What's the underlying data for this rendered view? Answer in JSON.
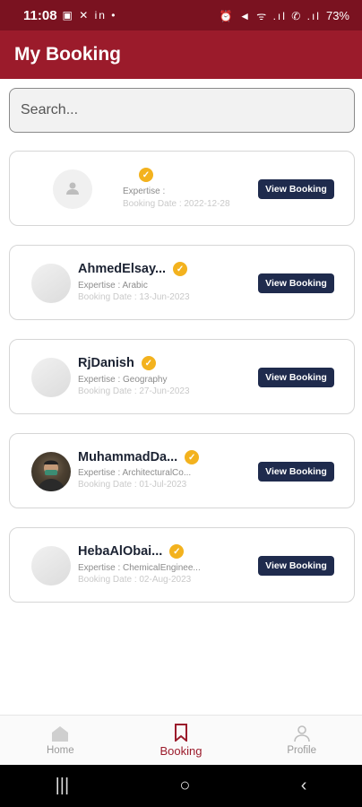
{
  "status_bar": {
    "time": "11:08",
    "left_icons": "▣ ✕ in •",
    "right_icons": "⏰ ◄ ᯤ .ıl ✆ .ıl",
    "battery": "73%"
  },
  "app_bar": {
    "title": "My Booking"
  },
  "search": {
    "placeholder": "Search..."
  },
  "bookings": [
    {
      "name": "",
      "expertise": "Expertise :",
      "date": "Booking Date : 2022-12-28",
      "button": "View Booking"
    },
    {
      "name": "AhmedElsay...",
      "expertise": "Expertise : Arabic",
      "date": "Booking Date : 13-Jun-2023",
      "button": "View Booking"
    },
    {
      "name": "RjDanish",
      "expertise": "Expertise : Geography",
      "date": "Booking Date : 27-Jun-2023",
      "button": "View Booking"
    },
    {
      "name": "MuhammadDa...",
      "expertise": "Expertise : ArchitecturalCo...",
      "date": "Booking Date : 01-Jul-2023",
      "button": "View Booking"
    },
    {
      "name": "HebaAlObai...",
      "expertise": "Expertise : ChemicalEnginee...",
      "date": "Booking Date : 02-Aug-2023",
      "button": "View Booking"
    }
  ],
  "bottom_nav": {
    "home": "Home",
    "booking": "Booking",
    "profile": "Profile"
  },
  "colors": {
    "brand": "#9b1b2b",
    "button": "#1f2b4d",
    "verified": "#f3b21e"
  },
  "system_nav": {
    "recents": "|||",
    "home": "○",
    "back": "‹"
  }
}
